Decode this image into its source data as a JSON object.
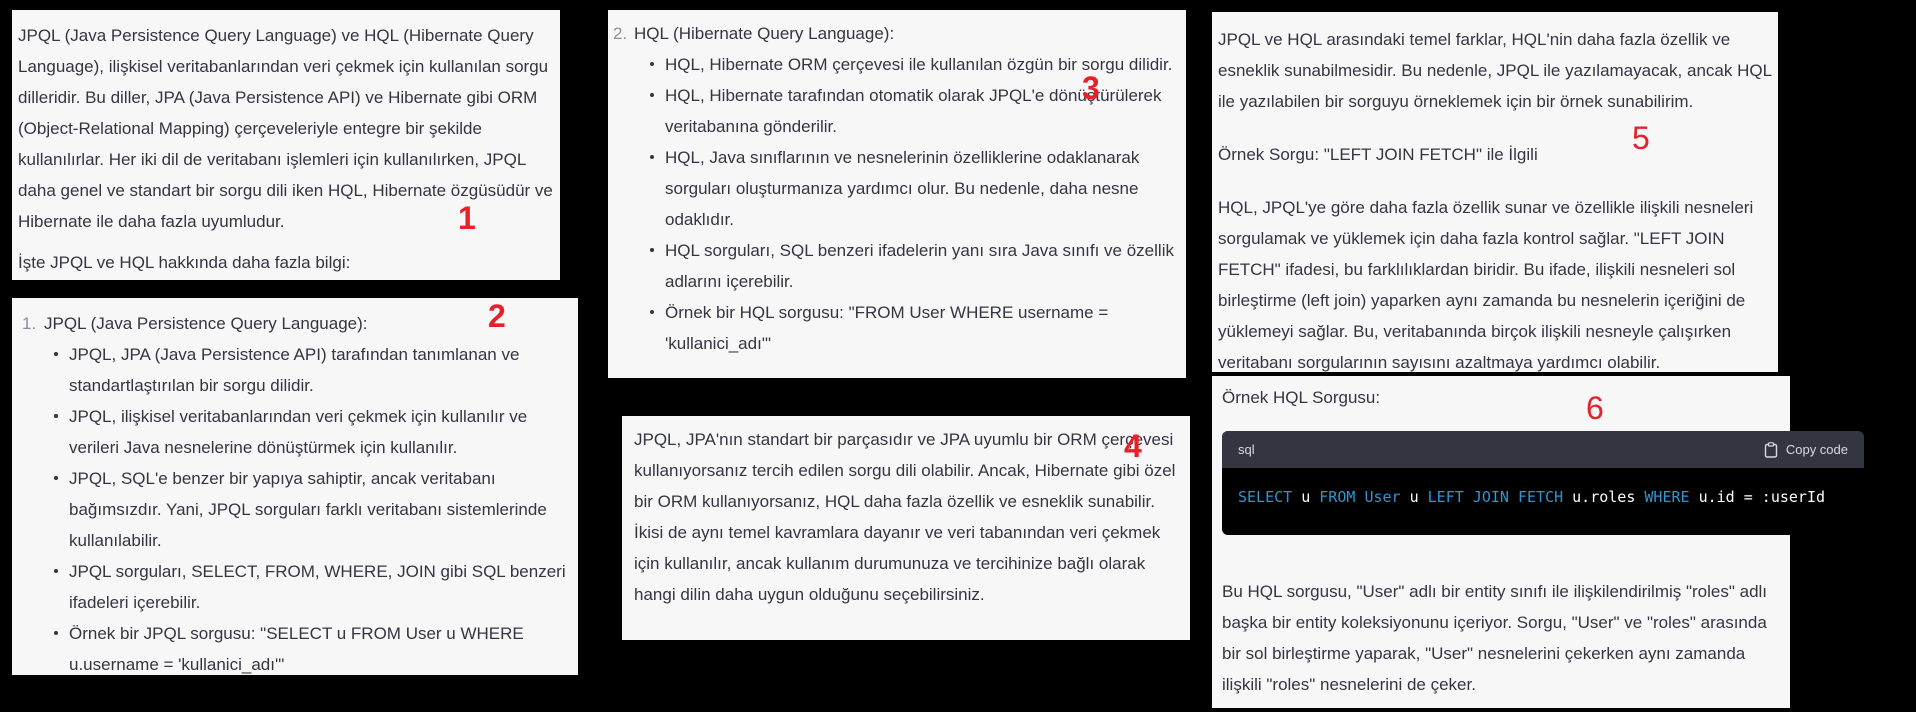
{
  "panel1": {
    "paragraph": "JPQL (Java Persistence Query Language) ve HQL (Hibernate Query Language), ilişkisel veritabanlarından veri çekmek için kullanılan sorgu dilleridir. Bu diller, JPA (Java Persistence API) ve Hibernate gibi ORM (Object-Relational Mapping) çerçeveleriyle entegre bir şekilde kullanılırlar. Her iki dil de veritabanı işlemleri için kullanılırken, JPQL daha genel ve standart bir sorgu dili iken HQL, Hibernate özgüsüdür ve Hibernate ile daha fazla uyumludur.",
    "footer": "İşte JPQL ve HQL hakkında daha fazla bilgi:",
    "marker": "1"
  },
  "panel2": {
    "item_number": "1.",
    "heading": "JPQL (Java Persistence Query Language):",
    "bullets": [
      "JPQL, JPA (Java Persistence API) tarafından tanımlanan ve standartlaştırılan bir sorgu dilidir.",
      "JPQL, ilişkisel veritabanlarından veri çekmek için kullanılır ve verileri Java nesnelerine dönüştürmek için kullanılır.",
      "JPQL, SQL'e benzer bir yapıya sahiptir, ancak veritabanı bağımsızdır. Yani, JPQL sorguları farklı veritabanı sistemlerinde kullanılabilir.",
      "JPQL sorguları, SELECT, FROM, WHERE, JOIN gibi SQL benzeri ifadeleri içerebilir.",
      "Örnek bir JPQL sorgusu: \"SELECT u FROM User u WHERE u.username = 'kullanici_adı'\""
    ],
    "marker": "2"
  },
  "panel3": {
    "item_number": "2.",
    "heading": "HQL (Hibernate Query Language):",
    "bullets": [
      "HQL, Hibernate ORM çerçevesi ile kullanılan özgün bir sorgu dilidir.",
      "HQL, Hibernate tarafından otomatik olarak JPQL'e dönüştürülerek veritabanına gönderilir.",
      "HQL, Java sınıflarının ve nesnelerinin özelliklerine odaklanarak sorguları oluşturmanıza yardımcı olur. Bu nedenle, daha nesne odaklıdır.",
      "HQL sorguları, SQL benzeri ifadelerin yanı sıra Java sınıfı ve özellik adlarını içerebilir.",
      "Örnek bir HQL sorgusu: \"FROM User WHERE username = 'kullanici_adı'\""
    ],
    "marker": "3"
  },
  "panel4": {
    "paragraph": "JPQL, JPA'nın standart bir parçasıdır ve JPA uyumlu bir ORM çerçevesi kullanıyorsanız tercih edilen sorgu dili olabilir. Ancak, Hibernate gibi özel bir ORM kullanıyorsanız, HQL daha fazla özellik ve esneklik sunabilir. İkisi de aynı temel kavramlara dayanır ve veri tabanından veri çekmek için kullanılır, ancak kullanım durumunuza ve tercihinize bağlı olarak hangi dilin daha uygun olduğunu seçebilirsiniz.",
    "marker": "4"
  },
  "panel5": {
    "paragraph1": "JPQL ve HQL arasındaki temel farklar, HQL'nin daha fazla özellik ve esneklik sunabilmesidir. Bu nedenle, JPQL ile yazılamayacak, ancak HQL ile yazılabilen bir sorguyu örneklemek için bir örnek sunabilirim.",
    "paragraph2": "Örnek Sorgu: \"LEFT JOIN FETCH\" ile İlgili",
    "paragraph3": "HQL, JPQL'ye göre daha fazla özellik sunar ve özellikle ilişkili nesneleri sorgulamak ve yüklemek için daha fazla kontrol sağlar. \"LEFT JOIN FETCH\" ifadesi, bu farklılıklardan biridir. Bu ifade, ilişkili nesneleri sol birleştirme (left join) yaparken aynı zamanda bu nesnelerin içeriğini de yüklemeyi sağlar. Bu, veritabanında birçok ilişkili nesneyle çalışırken veritabanı sorgularının sayısını azaltmaya yardımcı olabilir.",
    "marker": "5"
  },
  "panel6": {
    "heading": "Örnek HQL Sorgusu:",
    "code_lang": "sql",
    "copy_label": "Copy code",
    "copy_icon": "clipboard-icon",
    "code_tokens": {
      "t1": "SELECT",
      "t2": " u ",
      "t3": "FROM",
      "t4": " ",
      "t5": "User",
      "t6": " u ",
      "t7": "LEFT JOIN FETCH",
      "t8": " u.roles ",
      "t9": "WHERE",
      "t10": " u.id = :userId"
    },
    "paragraph": "Bu HQL sorgusu, \"User\" adlı bir entity sınıfı ile ilişkilendirilmiş \"roles\" adlı başka bir entity koleksiyonunu içeriyor. Sorgu, \"User\" ve \"roles\" arasında bir sol birleştirme yaparak, \"User\" nesnelerini çekerken aynı zamanda ilişkili \"roles\" nesnelerini de çeker.",
    "marker": "6"
  },
  "colors": {
    "background": "#000000",
    "panel": "#f7f7f8",
    "text": "#343541",
    "marker": "#e8202a",
    "code_keyword": "#2e95d3",
    "code_table": "#df3079"
  }
}
